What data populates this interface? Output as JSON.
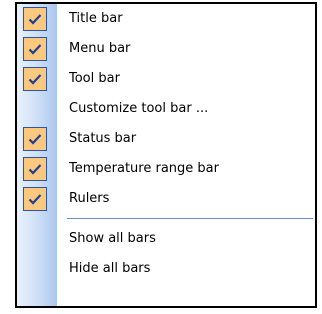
{
  "menu": {
    "items": [
      {
        "label": "Title bar",
        "checked": true
      },
      {
        "label": "Menu bar",
        "checked": true
      },
      {
        "label": "Tool bar",
        "checked": true
      },
      {
        "label": "Customize tool bar ...",
        "checked": false
      },
      {
        "label": "Status bar",
        "checked": true
      },
      {
        "label": "Temperature range bar",
        "checked": true
      },
      {
        "label": "Rulers",
        "checked": true
      }
    ],
    "actions": [
      {
        "label": "Show all bars"
      },
      {
        "label": "Hide all bars"
      }
    ]
  },
  "colors": {
    "check_fill": "#fbc880",
    "check_border": "#2c55a8",
    "gutter": "#c9dcf5",
    "separator": "#6d8fcb"
  }
}
